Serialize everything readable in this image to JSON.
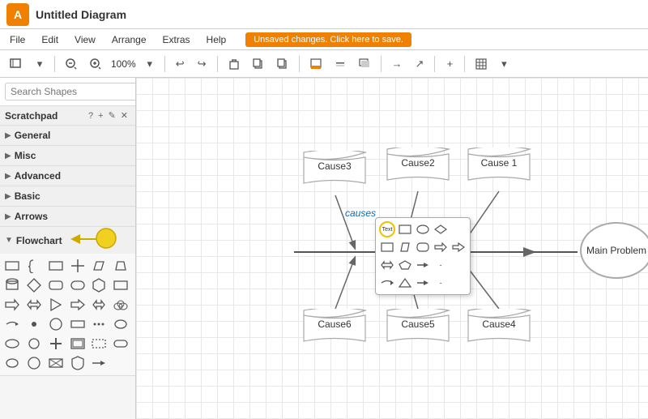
{
  "app": {
    "logo": "A",
    "title": "Untitled Diagram"
  },
  "menubar": {
    "items": [
      "File",
      "Edit",
      "View",
      "Arrange",
      "Extras",
      "Help"
    ],
    "unsaved": "Unsaved changes. Click here to save."
  },
  "toolbar": {
    "zoom": "100%",
    "zoom_in": "+",
    "zoom_out": "−",
    "undo": "↩",
    "redo": "↪",
    "delete": "🗑",
    "more": "+"
  },
  "sidebar": {
    "search_placeholder": "Search Shapes",
    "scratchpad_label": "Scratchpad",
    "sections": [
      {
        "id": "general",
        "label": "General",
        "expanded": false
      },
      {
        "id": "misc",
        "label": "Misc",
        "expanded": false
      },
      {
        "id": "advanced",
        "label": "Advanced",
        "expanded": false
      },
      {
        "id": "basic",
        "label": "Basic",
        "expanded": false
      },
      {
        "id": "arrows",
        "label": "Arrows",
        "expanded": false
      },
      {
        "id": "flowchart",
        "label": "Flowchart",
        "expanded": true
      }
    ]
  },
  "diagram": {
    "causes_label": "causes",
    "cause_labels": [
      "Cause3",
      "Cause2",
      "Cause 1",
      "Cause6",
      "Cause5",
      "Cause4"
    ],
    "main_problem": "Main Problem"
  },
  "colors": {
    "orange": "#f08000",
    "blue_label": "#0070c0",
    "shape_stroke": "#888"
  }
}
